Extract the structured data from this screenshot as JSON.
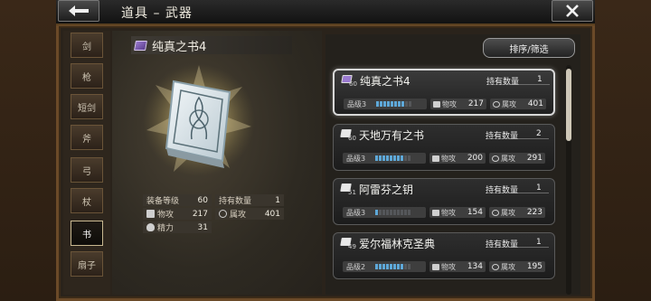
{
  "header": {
    "title": "道具 – 武器",
    "back_icon": "arrow-left-icon",
    "close_icon": "close-icon"
  },
  "tabs": [
    {
      "label": "剑",
      "active": false
    },
    {
      "label": "枪",
      "active": false
    },
    {
      "label": "短剑",
      "active": false
    },
    {
      "label": "斧",
      "active": false
    },
    {
      "label": "弓",
      "active": false
    },
    {
      "label": "杖",
      "active": false
    },
    {
      "label": "书",
      "active": true
    },
    {
      "label": "扇子",
      "active": false
    }
  ],
  "detail": {
    "name": "纯真之书4",
    "equip_level_label": "装备等级",
    "equip_level": "60",
    "owned_label": "持有数量",
    "owned": "1",
    "phys_label": "物攻",
    "phys": "217",
    "attr_label": "属攻",
    "attr": "401",
    "spirit_label": "精力",
    "spirit": "31"
  },
  "sort_button": "排序/筛选",
  "list": [
    {
      "level": "60",
      "name": "纯真之书4",
      "owned_label": "持有数量",
      "owned": "1",
      "rank_label": "品级3",
      "rank_fill": 0.8,
      "phys_label": "物攻",
      "phys": "217",
      "attr_label": "属攻",
      "attr": "401",
      "icon_color": "#9a7ad0",
      "selected": true
    },
    {
      "level": "60",
      "name": "天地万有之书",
      "owned_label": "持有数量",
      "owned": "2",
      "rank_label": "品级3",
      "rank_fill": 0.8,
      "phys_label": "物攻",
      "phys": "200",
      "attr_label": "属攻",
      "attr": "291",
      "icon_color": "#e8e8e8",
      "selected": false
    },
    {
      "level": "51",
      "name": "阿雷芬之钥",
      "owned_label": "持有数量",
      "owned": "1",
      "rank_label": "品级3",
      "rank_fill": 0.1,
      "phys_label": "物攻",
      "phys": "154",
      "attr_label": "属攻",
      "attr": "223",
      "icon_color": "#e8e8e8",
      "selected": false
    },
    {
      "level": "49",
      "name": "爱尔福林克圣典",
      "owned_label": "持有数量",
      "owned": "1",
      "rank_label": "品级2",
      "rank_fill": 0.8,
      "phys_label": "物攻",
      "phys": "134",
      "attr_label": "属攻",
      "attr": "195",
      "icon_color": "#e8e8e8",
      "selected": false
    }
  ],
  "colors": {
    "rank_bar": "#5ea8d8",
    "frame": "#6b4a28"
  }
}
